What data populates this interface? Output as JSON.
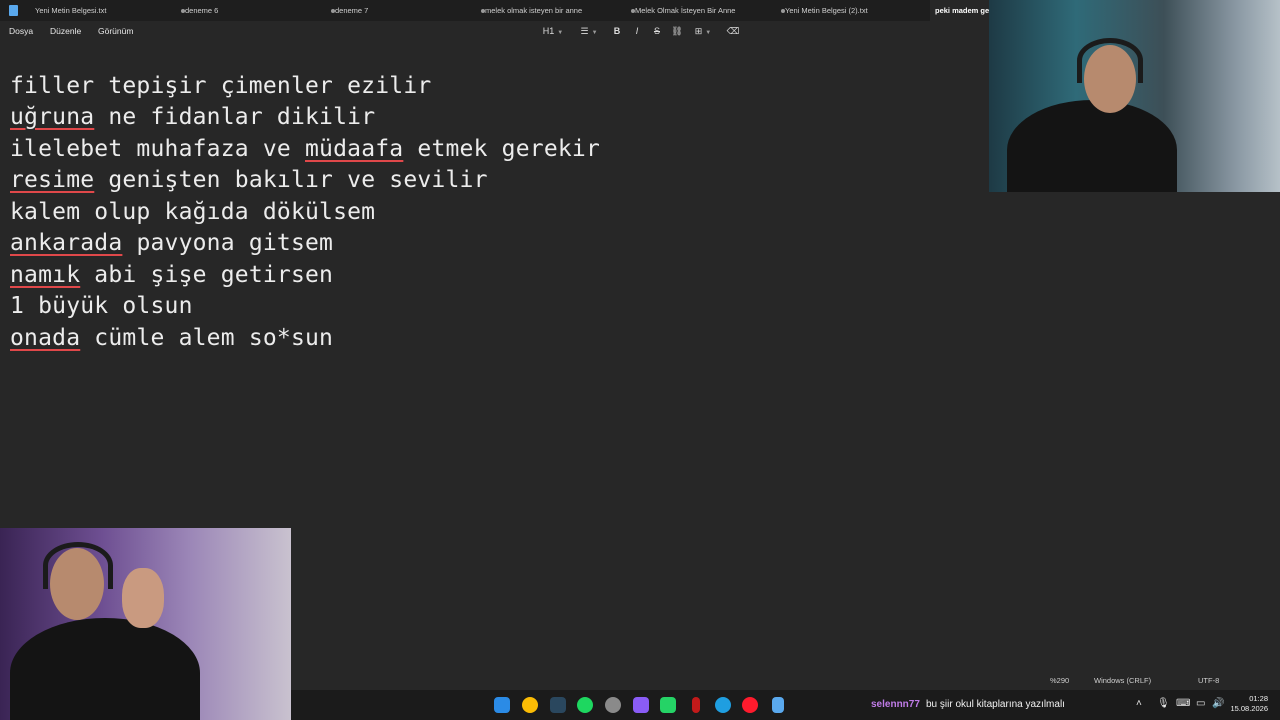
{
  "tabs": [
    {
      "label": "Yeni Metin Belgesi.txt",
      "modified": true
    },
    {
      "label": "deneme 6",
      "modified": true
    },
    {
      "label": "deneme 7",
      "modified": true
    },
    {
      "label": "melek olmak isteyen bir anne",
      "modified": true
    },
    {
      "label": "Melek Olmak İsteyen Bir Anne",
      "modified": true
    },
    {
      "label": "Yeni Metin Belgesi (2).txt",
      "modified": true
    },
    {
      "label": "peki madem gel",
      "active": true
    }
  ],
  "menu": {
    "file": "Dosya",
    "edit": "Düzenle",
    "view": "Görünüm"
  },
  "toolbar": {
    "heading": "H1",
    "list_icon": "list-icon",
    "bold": "B",
    "italic": "I",
    "strike": "S",
    "link_icon": "link-icon",
    "table_icon": "table-icon",
    "clear_icon": "clear-format-icon"
  },
  "editor": {
    "lines": [
      "filler tepişir çimenler ezilir",
      "uğruna ne fidanlar dikilir",
      "ilelebet muhafaza ve müdaafa etmek gerekir",
      "resime genişten bakılır ve sevilir",
      "kalem olup kağıda dökülsem",
      "ankarada pavyona gitsem",
      "namık abi şişe getirsen",
      "1 büyük olsun",
      "onada cümle alem so*sun"
    ]
  },
  "status": {
    "zoom": "%290",
    "line_ending": "Windows (CRLF)",
    "encoding": "UTF-8"
  },
  "taskbar": {
    "chat_user": "selennn77",
    "chat_message": "bu şiir okul kitaplarına yazılmalı",
    "time": "01:28",
    "date": "15.08.2026",
    "colors": {
      "spotify": "#1ed760",
      "whatsapp": "#25d366",
      "edge": "#1f9ee0",
      "opera": "#ff1b2d",
      "chrome": "#fbbc05",
      "chat_user": "#c07ce8"
    }
  }
}
